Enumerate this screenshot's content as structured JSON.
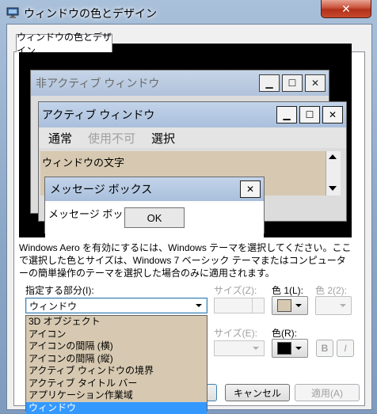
{
  "window": {
    "title": "ウィンドウの色とデザイン",
    "close_glyph": "✕"
  },
  "tab": {
    "label": "ウィンドウの色とデザイン"
  },
  "preview": {
    "inactive_title": "非アクティブ ウィンドウ",
    "active_title": "アクティブ ウィンドウ",
    "menu": {
      "normal": "通常",
      "disabled": "使用不可",
      "selected": "選択"
    },
    "window_text": "ウィンドウの文字",
    "message_title": "メッセージ ボックス",
    "message_text": "メッセージ ボックスの文字",
    "ok_label": "OK",
    "titlebar_buttons": {
      "minimize": "▁",
      "maximize": "☐",
      "close": "✕"
    }
  },
  "description": "Windows Aero を有効にするには、Windows テーマを選択してください。ここで選択した色とサイズは、Windows 7 ベーシック テーマまたはコンピューターの簡単操作のテーマを選択した場合のみに適用されます。",
  "item": {
    "label": "指定する部分(I):",
    "selected": "ウィンドウ",
    "options": [
      "3D オブジェクト",
      "アイコン",
      "アイコンの間隔 (横)",
      "アイコンの間隔 (縦)",
      "アクティブ ウィンドウの境界",
      "アクティブ タイトル バー",
      "アプリケーション作業域",
      "ウィンドウ"
    ]
  },
  "size1": {
    "label": "サイズ(Z):"
  },
  "color1": {
    "label": "色 1(L):",
    "value": "#d7c9b1"
  },
  "color2": {
    "label": "色 2(2):"
  },
  "font_size": {
    "label": "サイズ(E):"
  },
  "font_color": {
    "label": "色(R):",
    "value": "#000000"
  },
  "bold_label": "B",
  "italic_label": "I",
  "buttons": {
    "cancel": "キャンセル",
    "apply": "適用(A)"
  }
}
